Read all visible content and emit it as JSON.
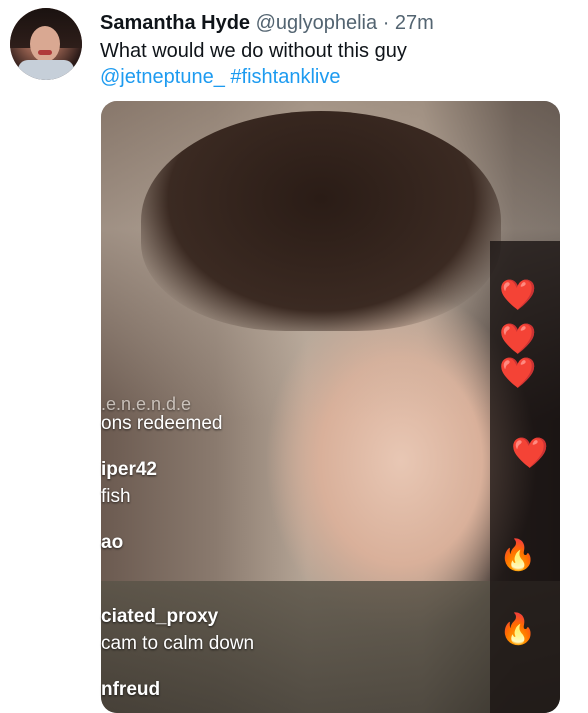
{
  "tweet": {
    "display_name": "Samantha Hyde",
    "handle": "@uglyophelia",
    "separator": "·",
    "time": "27m",
    "text": "What would we do without this guy",
    "mention": "@jetneptune_",
    "hashtag": "#fishtanklive"
  },
  "chat_overlay": [
    {
      "text": ".e.n.e.n.d.e",
      "style": "muted"
    },
    {
      "text": "ons redeemed",
      "style": "normal"
    },
    {
      "text": "iper42",
      "style": "user"
    },
    {
      "text": "fish",
      "style": "normal"
    },
    {
      "text": "ao",
      "style": "user"
    },
    {
      "text": "ciated_proxy",
      "style": "user"
    },
    {
      "text": "cam to calm down",
      "style": "normal"
    },
    {
      "text": "nfreud",
      "style": "user"
    }
  ],
  "reactions": [
    "heart-icon",
    "heart-icon",
    "heart-icon",
    "heart-icon",
    "fire-icon",
    "fire-icon"
  ]
}
